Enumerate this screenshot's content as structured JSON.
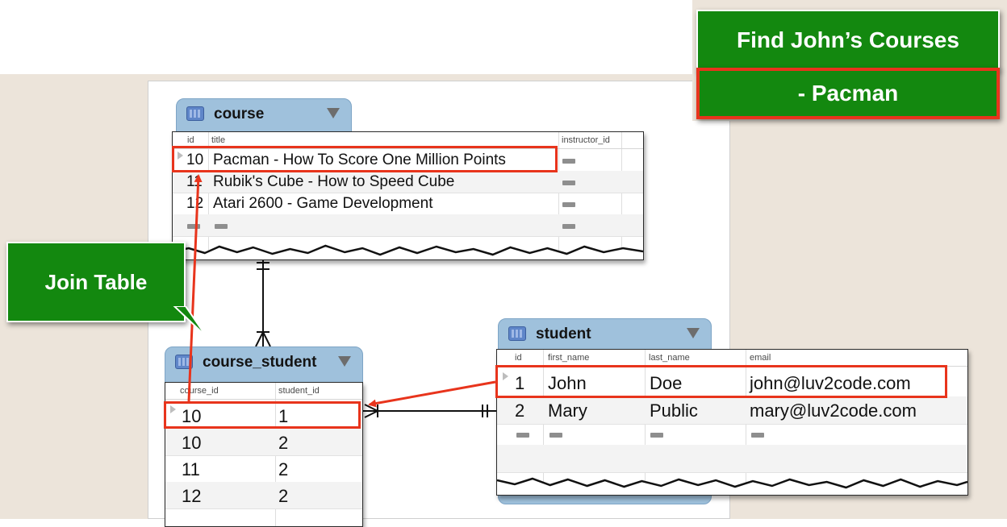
{
  "callouts": {
    "title": "Find John’s Courses",
    "result": "- Pacman",
    "join_table": "Join Table"
  },
  "colors": {
    "callout_green": "#13880f",
    "highlight_red": "#e8341c",
    "entity_header_blue": "#9fc1dc",
    "backdrop": "#ece4da"
  },
  "course": {
    "name": "course",
    "columns": [
      "id",
      "title",
      "instructor_id"
    ],
    "rows": [
      {
        "id": "10",
        "title": "Pacman - How To Score One Million Points",
        "instructor_id": "NULL"
      },
      {
        "id": "11",
        "title": "Rubik's Cube - How to Speed Cube",
        "instructor_id": "NULL"
      },
      {
        "id": "12",
        "title": "Atari 2600 - Game Development",
        "instructor_id": "NULL"
      },
      {
        "id": "NULL",
        "title": "NULL",
        "instructor_id": "NULL"
      }
    ]
  },
  "course_student": {
    "name": "course_student",
    "columns": [
      "course_id",
      "student_id"
    ],
    "rows": [
      {
        "course_id": "10",
        "student_id": "1"
      },
      {
        "course_id": "10",
        "student_id": "2"
      },
      {
        "course_id": "11",
        "student_id": "2"
      },
      {
        "course_id": "12",
        "student_id": "2"
      }
    ]
  },
  "student": {
    "name": "student",
    "columns": [
      "id",
      "first_name",
      "last_name",
      "email"
    ],
    "rows": [
      {
        "id": "1",
        "first_name": "John",
        "last_name": "Doe",
        "email": "john@luv2code.com"
      },
      {
        "id": "2",
        "first_name": "Mary",
        "last_name": "Public",
        "email": "mary@luv2code.com"
      },
      {
        "id": "NULL",
        "first_name": "NULL",
        "last_name": "NULL",
        "email": "NULL"
      }
    ]
  },
  "icons": {
    "table": "table-icon",
    "menu": "dropdown-triangle-icon",
    "null": "null-badge",
    "row_marker": "row-pointer-icon"
  }
}
